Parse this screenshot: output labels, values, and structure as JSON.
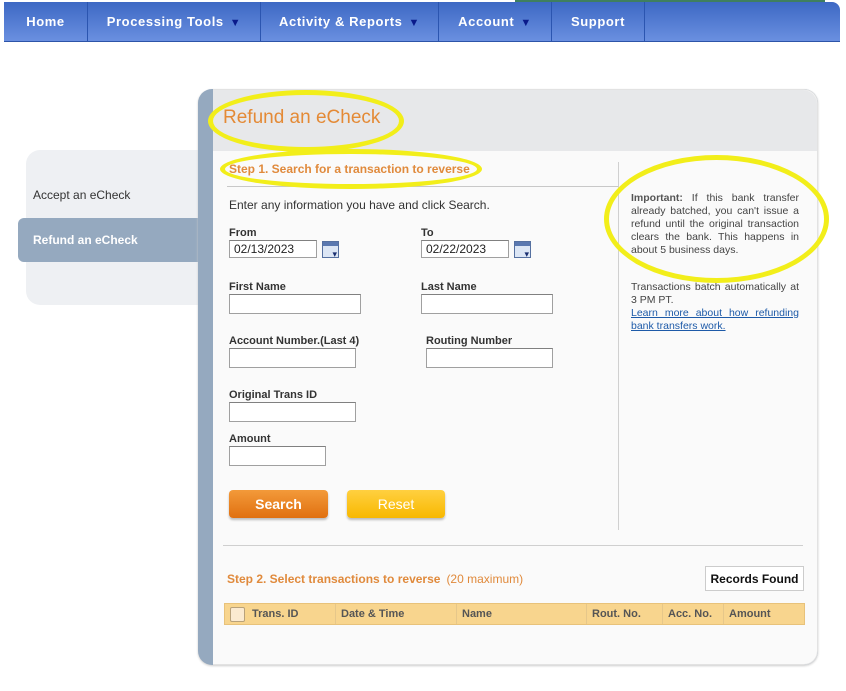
{
  "nav": {
    "items": [
      {
        "label": "Home",
        "has_dropdown": false
      },
      {
        "label": "Processing Tools",
        "has_dropdown": true
      },
      {
        "label": "Activity & Reports",
        "has_dropdown": true
      },
      {
        "label": "Account",
        "has_dropdown": true
      },
      {
        "label": "Support",
        "has_dropdown": false
      }
    ],
    "dropdown_glyph": "▼"
  },
  "sidebar": {
    "items": [
      {
        "label": "Accept an eCheck",
        "active": false
      },
      {
        "label": "Refund an eCheck",
        "active": true
      }
    ]
  },
  "page": {
    "title": "Refund an eCheck",
    "step1": {
      "heading": "Step 1. Search for a transaction to reverse",
      "intro": "Enter any information you have and click Search.",
      "fields": {
        "from": {
          "label": "From",
          "value": "02/13/2023"
        },
        "to": {
          "label": "To",
          "value": "02/22/2023"
        },
        "first_name": {
          "label": "First Name",
          "value": ""
        },
        "last_name": {
          "label": "Last Name",
          "value": ""
        },
        "account_number": {
          "label": "Account Number.(Last 4)",
          "value": ""
        },
        "routing_number": {
          "label": "Routing Number",
          "value": ""
        },
        "original_trans_id": {
          "label": "Original Trans ID",
          "value": ""
        },
        "amount": {
          "label": "Amount",
          "value": ""
        }
      },
      "search_label": "Search",
      "reset_label": "Reset"
    },
    "info": {
      "important_label": "Important:",
      "important_text": " If this bank transfer already batched, you can't issue a refund until the original transaction clears the bank. This happens in about 5 business days.",
      "batch_text": "Transactions batch automatically at 3 PM PT.",
      "learn_more_link": "Learn more about how refunding bank transfers work."
    },
    "step2": {
      "heading": "Step 2. Select transactions to reverse",
      "max_note": "(20 maximum)",
      "records_found_label": "Records Found",
      "columns": [
        "Trans. ID",
        "Date & Time",
        "Name",
        "Rout. No.",
        "Acc. No.",
        "Amount"
      ]
    }
  },
  "colors": {
    "accent_orange": "#e08a3c",
    "nav_blue": "#3d68c4",
    "highlight_yellow": "#f2ee1a",
    "table_header": "#f8d58e"
  }
}
